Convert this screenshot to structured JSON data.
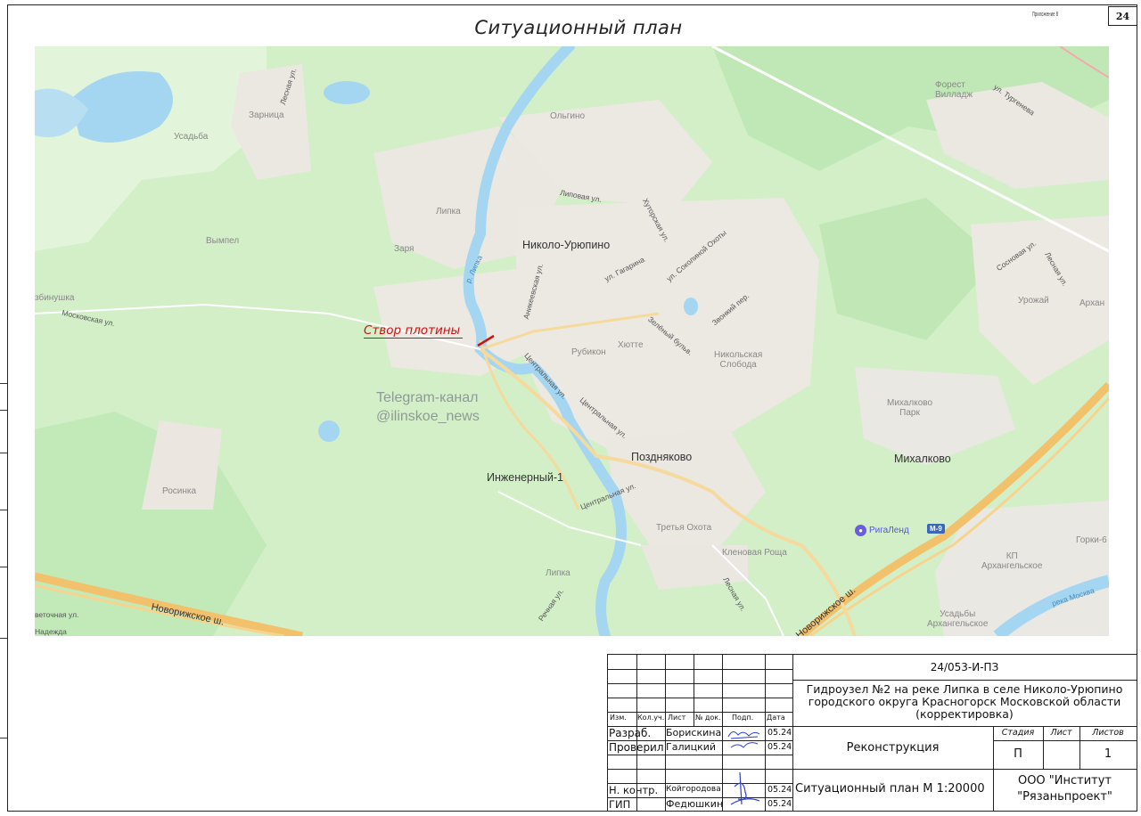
{
  "sheet": {
    "number": "24",
    "appendix_note": "Приложение 8",
    "title": "Ситуационный план"
  },
  "map": {
    "dam_label": "Створ плотины",
    "watermark_line1": "Telegram-канал",
    "watermark_line2": "@ilinskoe_news",
    "towns": {
      "nikolo": "Николо-Урюпино",
      "pozdnyakovo": "Поздняково",
      "inzhenerny": "Инженерный-1",
      "mikhalkovo": "Михалково"
    },
    "places": {
      "forest_line1": "Форест",
      "forest_line2": "Вилладж",
      "zarnitsa": "Зарница",
      "usadba": "Усадьба",
      "olgino": "Ольгино",
      "lipka": "Липка",
      "vympel": "Вымпел",
      "zarya": "Заря",
      "rubikon": "Рубикон",
      "hyutte": "Хютте",
      "nikolskaya_line1": "Никольская",
      "nikolskaya_line2": "Слобода",
      "mikhalkovo_park_line1": "Михалково",
      "mikhalkovo_park_line2": "Парк",
      "rosinka": "Росинка",
      "tretya_okhota": "Третья Охота",
      "klenovaya": "Кленовая Роща",
      "lipka2": "Липка",
      "urozhay": "Урожай",
      "arkh": "Архан",
      "kp_line1": "КП",
      "kp_line2": "Архангельское",
      "usadby_line1": "Усадьбы",
      "usadby_line2": "Архангельское",
      "gorki": "Горки-6",
      "tsbinushka": "збинушка",
      "svetochnaya": "веточная ул.",
      "nadezhda": "Надежда"
    },
    "streets": {
      "lesnaya": "Лесная ул.",
      "turgeneva": "ул. Тургенева",
      "lipovaya": "Липовая ул.",
      "hutorskaya": "Хуторская ул.",
      "gagarina": "ул. Гагарина",
      "sokolinoy": "ул. Соколиной Охоты",
      "anikeevskaya": "Аникеевская ул.",
      "zeleny": "Зелёный бульв.",
      "zvonkiy": "Звонкий пер.",
      "centralnaya1": "Центральная ул.",
      "centralnaya2": "Центральная ул.",
      "centralnaya3": "Центральная ул.",
      "moskovskaya": "Московская ул.",
      "novorizhskoe1": "Новорижское ш.",
      "novorizhskoe2": "Новорижское ш.",
      "rechnaya": "Речная ул.",
      "lesnaya2": "Лесная ул.",
      "sosnovaya": "Сосновая ул.",
      "lesnaya3": "Лесная ул.",
      "river_lipka": "р. Липка",
      "river_moskva": "река Москва"
    },
    "poi": {
      "riga_land": "РигаЛенд",
      "m9": "М-9"
    }
  },
  "title_block": {
    "doc_code": "24/053-И-ПЗ",
    "project_line1": "Гидроузел №2 на реке Липка в селе Николо-Урюпино",
    "project_line2": "городского округа Красногорск Московской области",
    "project_line3": "(корректировка)",
    "headers": {
      "izm": "Изм.",
      "kol": "Кол.уч.",
      "list": "Лист",
      "ndoc": "№ док.",
      "podp": "Подп.",
      "date": "Дата"
    },
    "rows": [
      {
        "role": "Разраб.",
        "name": "Борискина",
        "date": "05.24"
      },
      {
        "role": "Проверил",
        "name": "Галицкий",
        "date": "05.24"
      },
      {
        "role": "Н. контр.",
        "name": "Койгородова",
        "date": "05.24"
      },
      {
        "role": "ГИП",
        "name": "Федюшкин",
        "date": "05.24"
      }
    ],
    "stage_title": "Реконструкция",
    "stage_header": "Стадия",
    "sheet_header": "Лист",
    "sheets_header": "Листов",
    "stage_value": "П",
    "sheet_value": "",
    "sheets_value": "1",
    "drawing_name": "Ситуационный план М 1:20000",
    "org_line1": "ООО \"Институт",
    "org_line2": "\"Рязаньпроект\""
  },
  "colors": {
    "forest": "#c6ecbd",
    "settlement": "#ece9e3",
    "water": "#a4d6f2",
    "highway": "#f5c870",
    "dam_line": "#cc1111"
  }
}
